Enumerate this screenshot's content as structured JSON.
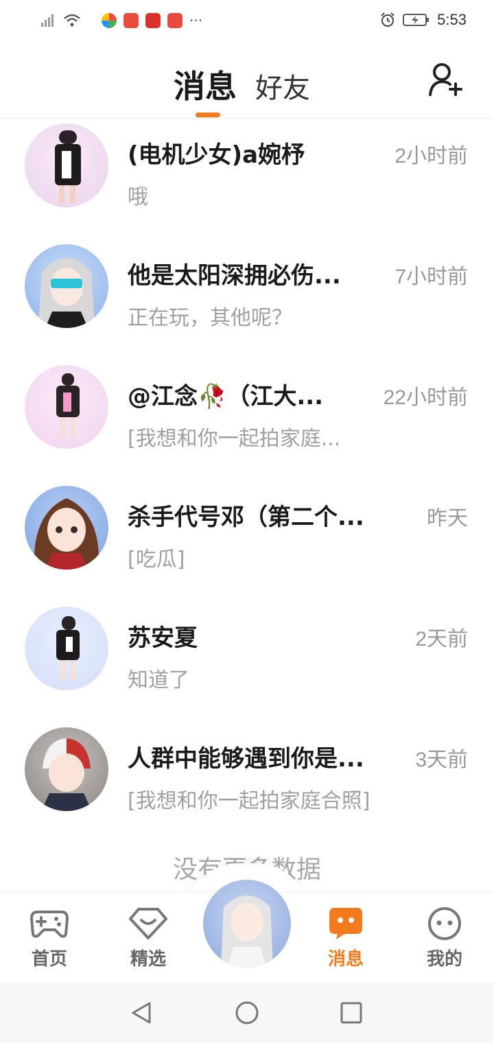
{
  "status_bar": {
    "time": "5:53",
    "overflow_indicator": "···",
    "battery_icon": "battery-charging-icon",
    "alarm_icon": "alarm-icon"
  },
  "header": {
    "tab_active": "消息",
    "tab_inactive": "好友",
    "add_friend_icon": "add-friend-icon",
    "accent_color": "#f37b1d"
  },
  "conversations": [
    {
      "name": "(电机少女)a婉杼",
      "time": "2小时前",
      "preview": "哦"
    },
    {
      "name": "他是太阳深拥必伤...",
      "time": "7小时前",
      "preview": "正在玩，其他呢？"
    },
    {
      "name": "@江念🥀（江大...",
      "time": "22小时前",
      "preview": "[我想和你一起拍家庭..."
    },
    {
      "name": "杀手代号邓（第二个...",
      "time": "昨天",
      "preview": "[吃瓜]"
    },
    {
      "name": "苏安夏",
      "time": "2天前",
      "preview": "知道了"
    },
    {
      "name": "人群中能够遇到你是...",
      "time": "3天前",
      "preview": "[我想和你一起拍家庭合照]"
    }
  ],
  "no_more_text": "没有更多数据",
  "bottom_nav": {
    "home": "首页",
    "featured": "精选",
    "messages": "消息",
    "mine": "我的"
  }
}
